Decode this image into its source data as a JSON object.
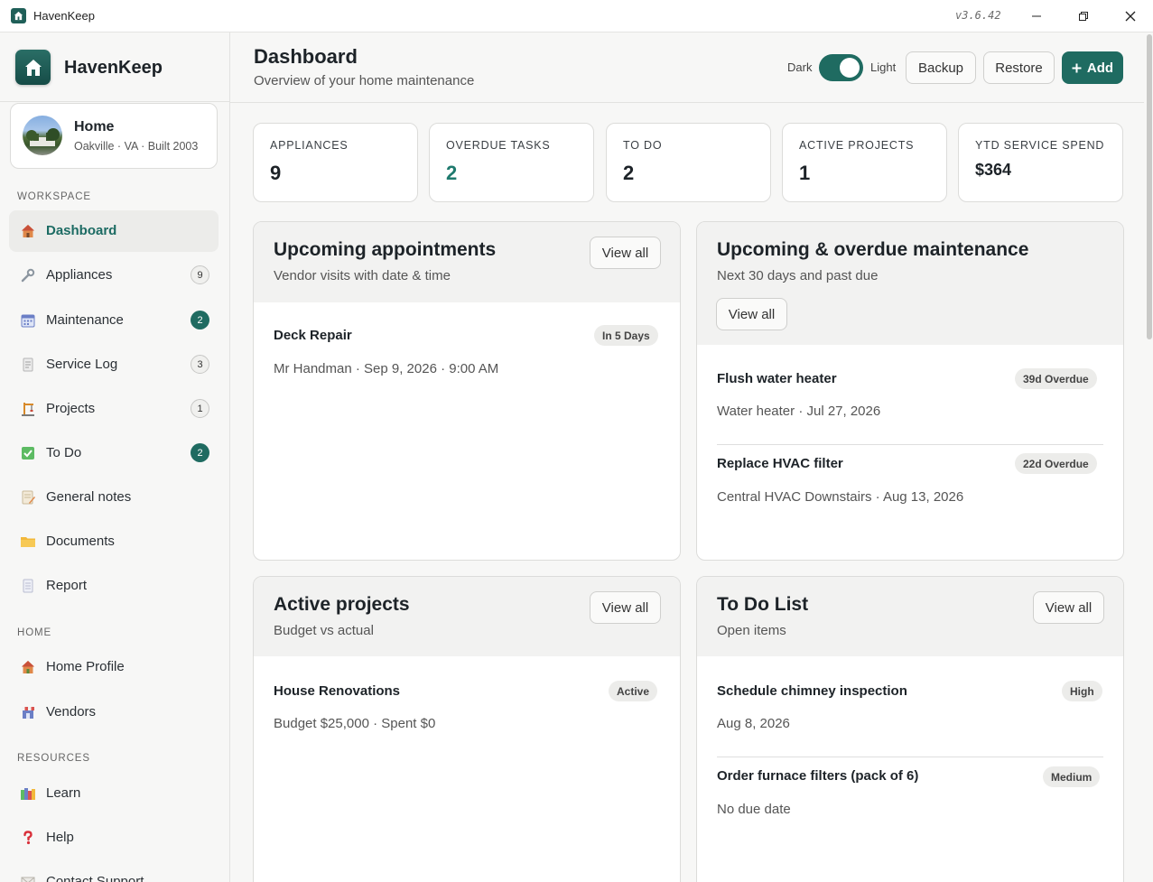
{
  "titlebar": {
    "app_name": "HavenKeep",
    "version": "v3.6.42"
  },
  "sidebar": {
    "brand": "HavenKeep",
    "home": {
      "name": "Home",
      "details": "Oakville · VA · Built 2003"
    },
    "sections": {
      "workspace": "WORKSPACE",
      "home": "HOME",
      "resources": "RESOURCES"
    },
    "workspace_items": [
      {
        "label": "Dashboard",
        "icon": "house-icon"
      },
      {
        "label": "Appliances",
        "icon": "wrench-icon",
        "badge": "9"
      },
      {
        "label": "Maintenance",
        "icon": "calendar-icon",
        "badge": "2"
      },
      {
        "label": "Service Log",
        "icon": "document-icon",
        "badge": "3"
      },
      {
        "label": "Projects",
        "icon": "crane-icon",
        "badge": "1"
      },
      {
        "label": "To Do",
        "icon": "checkbox-icon",
        "badge": "2"
      },
      {
        "label": "General notes",
        "icon": "memo-icon"
      },
      {
        "label": "Documents",
        "icon": "folder-icon"
      },
      {
        "label": "Report",
        "icon": "page-icon"
      }
    ],
    "home_items": [
      {
        "label": "Home Profile",
        "icon": "house-icon"
      },
      {
        "label": "Vendors",
        "icon": "store-icon"
      }
    ],
    "resource_items": [
      {
        "label": "Learn",
        "icon": "books-icon"
      },
      {
        "label": "Help",
        "icon": "question-icon"
      },
      {
        "label": "Contact Support",
        "icon": "envelope-icon"
      }
    ]
  },
  "header": {
    "title": "Dashboard",
    "subtitle": "Overview of your home maintenance",
    "theme_dark": "Dark",
    "theme_light": "Light",
    "backup": "Backup",
    "restore": "Restore",
    "add": "Add"
  },
  "stats": [
    {
      "label": "APPLIANCES",
      "value": "9"
    },
    {
      "label": "OVERDUE TASKS",
      "value": "2"
    },
    {
      "label": "TO DO",
      "value": "2"
    },
    {
      "label": "ACTIVE PROJECTS",
      "value": "1"
    },
    {
      "label": "YTD SERVICE SPEND",
      "value": "$364"
    }
  ],
  "appointments": {
    "title": "Upcoming appointments",
    "subtitle": "Vendor visits with date & time",
    "view_all": "View all",
    "items": [
      {
        "title": "Deck Repair",
        "meta": "Mr Handman · Sep 9, 2026 · 9:00 AM",
        "badge": "In 5 Days"
      }
    ]
  },
  "maintenance": {
    "title": "Upcoming & overdue maintenance",
    "subtitle": "Next 30 days and past due",
    "view_all": "View all",
    "items": [
      {
        "title": "Flush water heater",
        "meta": "Water heater · Jul 27, 2026",
        "badge": "39d Overdue"
      },
      {
        "title": "Replace HVAC filter",
        "meta": "Central HVAC Downstairs · Aug 13, 2026",
        "badge": "22d Overdue"
      }
    ]
  },
  "projects": {
    "title": "Active projects",
    "subtitle": "Budget vs actual",
    "view_all": "View all",
    "items": [
      {
        "title": "House Renovations",
        "meta": "Budget $25,000 · Spent $0",
        "badge": "Active"
      }
    ]
  },
  "todo": {
    "title": "To Do List",
    "subtitle": "Open items",
    "view_all": "View all",
    "items": [
      {
        "title": "Schedule chimney inspection",
        "meta": "Aug 8, 2026",
        "badge": "High"
      },
      {
        "title": "Order furnace filters (pack of 6)",
        "meta": "No due date",
        "badge": "Medium"
      }
    ]
  },
  "colors": {
    "accent": "#1f6b61",
    "accent_text": "#1f7a6e"
  }
}
